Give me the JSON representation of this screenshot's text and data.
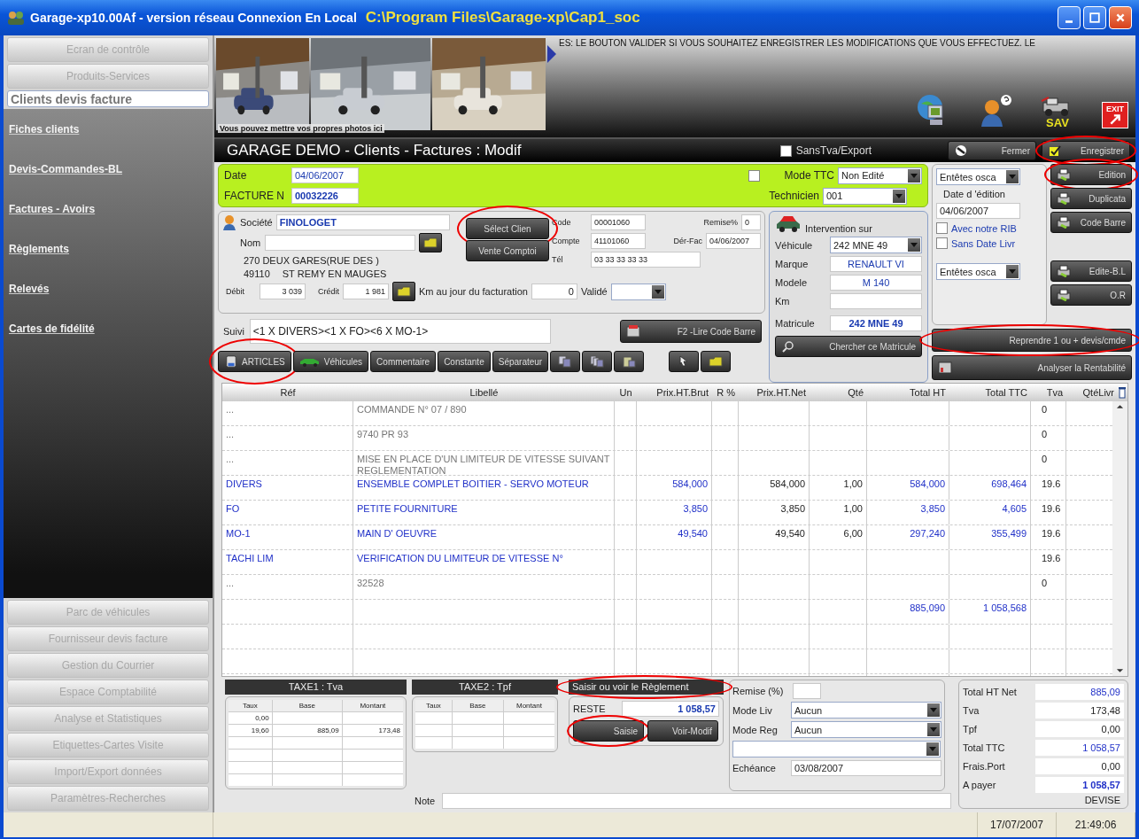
{
  "window": {
    "title": "Garage-xp10.00Af - version réseau Connexion En Local",
    "path": "C:\\Program Files\\Garage-xp\\Cap1_soc"
  },
  "sidebar": {
    "top_buttons": [
      {
        "label": "Ecran de contrôle",
        "selected": false
      },
      {
        "label": "Produits-Services",
        "selected": false
      },
      {
        "label": "Clients devis facture",
        "selected": true
      }
    ],
    "links": [
      "Fiches clients",
      "Devis-Commandes-BL",
      "Factures - Avoirs",
      "Règlements",
      "Relevés",
      "Cartes de fidélité"
    ],
    "bottom_buttons": [
      "Parc de véhicules",
      "Fournisseur devis facture",
      "Gestion du Courrier",
      "Espace Comptabilité",
      "Analyse et Statistiques",
      "Etiquettes-Cartes Visite",
      "Import/Export données",
      "Paramètres-Recherches"
    ]
  },
  "banner": {
    "photo_caption": "Vous pouvez mettre vos propres photos ici",
    "message": "ES: LE BOUTON VALIDER SI VOUS SOUHAITEZ ENREGISTRER LES MODIFICATIONS QUE VOUS EFFECTUEZ. LE",
    "sav_label": "SAV",
    "exit_label": "EXIT"
  },
  "form_header": {
    "title": "GARAGE DEMO - Clients - Factures : Modif",
    "sanstva": {
      "label": "SansTva/Export",
      "checked": false
    },
    "buttons": [
      {
        "label": "Fermer",
        "circled": false
      },
      {
        "label": "Enregistrer",
        "circled": true
      }
    ]
  },
  "invoice": {
    "date_label": "Date",
    "date": "04/06/2007",
    "number_label": "FACTURE N",
    "number": "00032226",
    "mode_ttc": {
      "label": "Mode TTC",
      "checked": false
    },
    "status": "Non Edité",
    "technician_label": "Technicien",
    "technician": "001"
  },
  "client": {
    "societe_label": "Société",
    "societe": "FINOLOGET",
    "nom_label": "Nom",
    "address": "270 DEUX GARES(RUE DES )",
    "postcode": "49110",
    "city": "ST REMY EN MAUGES",
    "debit_label": "Débit",
    "debit": "3 039",
    "credit_label": "Crédit",
    "credit": "1 981",
    "km_label": "Km au jour du facturation",
    "km": "0",
    "valide_label": "Validé",
    "buttons": [
      {
        "label": "Sélect Clien",
        "circled": true
      },
      {
        "label": "Vente Comptoi",
        "circled": false
      }
    ],
    "code_label": "Code",
    "code": "00001060",
    "remise_label": "Remise%",
    "remise": "0",
    "compte_label": "Compte",
    "compte": "41101060",
    "derfac_label": "Dér-Fac",
    "derfac": "04/06/2007",
    "tel_label": "Tél",
    "tel": "03 33 33 33 33"
  },
  "suivi": {
    "label": "Suivi",
    "value": "<1 X DIVERS><1 X FO><6 X MO-1>",
    "barcode_button": "F2 -Lire Code Barre"
  },
  "toolbar": [
    {
      "label": "ARTICLES",
      "circled": true
    },
    {
      "label": "Véhicules",
      "circled": false
    },
    {
      "label": "Commentaire",
      "circled": false
    },
    {
      "label": "Constante",
      "circled": false
    },
    {
      "label": "Séparateur",
      "circled": false
    }
  ],
  "vehicle": {
    "title": "Intervention sur",
    "vehicle_label": "Véhicule",
    "vehicle": "242 MNE 49",
    "marque_label": "Marque",
    "marque": "RENAULT VI",
    "modele_label": "Modele",
    "modele": "M 140",
    "km_label": "Km",
    "matricule_label": "Matricule",
    "matricule": "242 MNE 49",
    "search_button": "Chercher ce Matricule"
  },
  "print": {
    "header_select": "Entêtes osca",
    "date_label": "Date d 'édition",
    "date": "04/06/2007",
    "options": [
      {
        "label": "Avec notre RIB",
        "checked": false
      },
      {
        "label": "Sans Date Livr",
        "checked": false
      }
    ],
    "footer_select": "Entêtes osca",
    "buttons": [
      {
        "label": "Edition",
        "circled": true
      },
      {
        "label": "Duplicata",
        "circled": false
      },
      {
        "label": "Code Barre",
        "circled": false
      },
      {
        "label": "Edite-B.L",
        "circled": false
      },
      {
        "label": "O.R",
        "circled": false
      }
    ],
    "reprendre": {
      "label": "Reprendre 1 ou + devis/cmde",
      "circled": true
    },
    "analyse": "Analyser la Rentabilité"
  },
  "table": {
    "columns": [
      "Réf",
      "Libellé",
      "Un",
      "Prix.HT.Brut",
      "R %",
      "Prix.HT.Net",
      "Qté",
      "Total HT",
      "Total TTC",
      "Tva",
      "QtéLivr"
    ],
    "rows": [
      {
        "kind": "comment",
        "ref": "...",
        "label": "COMMANDE N°  07 / 890",
        "tva": "0"
      },
      {
        "kind": "comment",
        "ref": "...",
        "label": "9740 PR 93",
        "tva": "0"
      },
      {
        "kind": "comment",
        "ref": "...",
        "label": "MISE EN PLACE D'UN LIMITEUR DE VITESSE SUIVANT REGLEMENTATION",
        "tva": "0"
      },
      {
        "kind": "article",
        "ref": "DIVERS",
        "label": "ENSEMBLE COMPLET BOITIER - SERVO MOTEUR",
        "brut": "584,000",
        "net": "584,000",
        "qty": "1,00",
        "total_ht": "584,000",
        "total_ttc": "698,464",
        "tva": "19.6"
      },
      {
        "kind": "article",
        "ref": "FO",
        "label": "PETITE FOURNITURE",
        "brut": "3,850",
        "net": "3,850",
        "qty": "1,00",
        "total_ht": "3,850",
        "total_ttc": "4,605",
        "tva": "19.6"
      },
      {
        "kind": "article",
        "ref": "MO-1",
        "label": "MAIN D' OEUVRE",
        "brut": "49,540",
        "net": "49,540",
        "qty": "6,00",
        "total_ht": "297,240",
        "total_ttc": "355,499",
        "tva": "19.6"
      },
      {
        "kind": "article",
        "ref": "TACHI LIM",
        "label": "VERIFICATION DU LIMITEUR DE VITESSE  N°",
        "tva": "19.6"
      },
      {
        "kind": "comment",
        "ref": "...",
        "label": "32528",
        "tva": "0"
      },
      {
        "kind": "total",
        "total_ht": "885,090",
        "total_ttc": "1 058,568"
      }
    ]
  },
  "taxes": [
    {
      "title": "TAXE1 : Tva",
      "columns": [
        "Taux",
        "Base",
        "Montant"
      ],
      "rows": [
        {
          "taux": "0,00"
        },
        {
          "taux": "19,60",
          "base": "885,09",
          "montant": "173,48"
        }
      ]
    },
    {
      "title": "TAXE2 : Tpf",
      "columns": [
        "Taux",
        "Base",
        "Montant"
      ]
    }
  ],
  "payment": {
    "title": "Saisir ou voir le Règlement",
    "circled": true,
    "reste_label": "RESTE",
    "reste": "1 058,57",
    "buttons": [
      {
        "label": "Saisie",
        "circled": true
      },
      {
        "label": "Voir-Modif",
        "circled": false
      }
    ]
  },
  "terms": {
    "remise_label": "Remise (%)",
    "mode_liv_label": "Mode Liv",
    "mode_liv": "Aucun",
    "mode_reg_label": "Mode Reg",
    "mode_reg": "Aucun",
    "echeance_label": "Echéance",
    "echeance": "03/08/2007"
  },
  "note_label": "Note",
  "totals": {
    "items": [
      {
        "label": "Total HT Net",
        "value": "885,09",
        "kind": "total"
      },
      {
        "label": "Tva",
        "value": "173,48",
        "kind": "charge"
      },
      {
        "label": "Tpf",
        "value": "0,00",
        "kind": "charge"
      },
      {
        "label": "Total TTC",
        "value": "1 058,57",
        "kind": "total"
      },
      {
        "label": "Frais.Port",
        "value": "0,00",
        "kind": "charge"
      },
      {
        "label": "A payer",
        "value": "1 058,57",
        "kind": "due"
      }
    ],
    "currency": "DEVISE"
  },
  "status_bar": {
    "date": "17/07/2007",
    "time": "21:49:06"
  }
}
